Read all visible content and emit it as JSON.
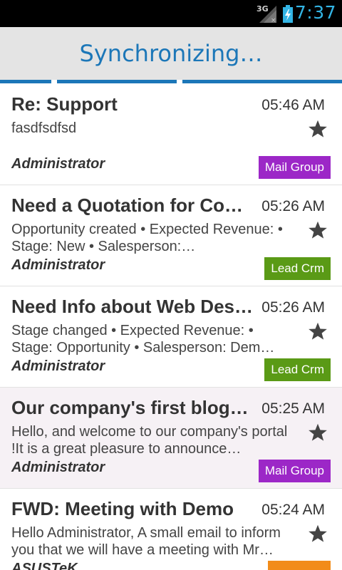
{
  "status_bar": {
    "network_label": "3G",
    "time": "7:37",
    "icons": [
      "signal-icon",
      "battery-charging-icon"
    ]
  },
  "action_bar": {
    "title": "Synchronizing…"
  },
  "colors": {
    "accent": "#1c77b8",
    "status_text": "#33b5e5",
    "mail_group": "#9c27c7",
    "lead_crm": "#5a9a16",
    "orange_tag": "#f28c1a"
  },
  "messages": [
    {
      "subject": "Re: Support",
      "time": "05:46 AM",
      "body": "fasdfsdfsd",
      "author": "Administrator",
      "tag": "Mail Group",
      "starred": true
    },
    {
      "subject": "Need a Quotation for Com…",
      "time": "05:26 AM",
      "body": "Opportunity created     • Expected Revenue:     • Stage: New     • Salesperson:…",
      "author": "Administrator",
      "tag": "Lead Crm",
      "starred": true
    },
    {
      "subject": "Need Info about Web Desi…",
      "time": "05:26 AM",
      "body": "Stage changed     • Expected Revenue:     • Stage: Opportunity     • Salesperson: Dem…",
      "author": "Administrator",
      "tag": "Lead Crm",
      "starred": true
    },
    {
      "subject": "Our company's first blog-…",
      "time": "05:25 AM",
      "body": "Hello, and welcome to our company's portal !It is a great pleasure to announce…",
      "author": "Administrator",
      "tag": "Mail Group",
      "starred": true
    },
    {
      "subject": "FWD: Meeting with Demo",
      "time": "05:24 AM",
      "body": "Hello Administrator, A small email to inform you that we will have a meeting with Mr…",
      "author": "ASUSTeK",
      "tag": "",
      "starred": true
    }
  ]
}
